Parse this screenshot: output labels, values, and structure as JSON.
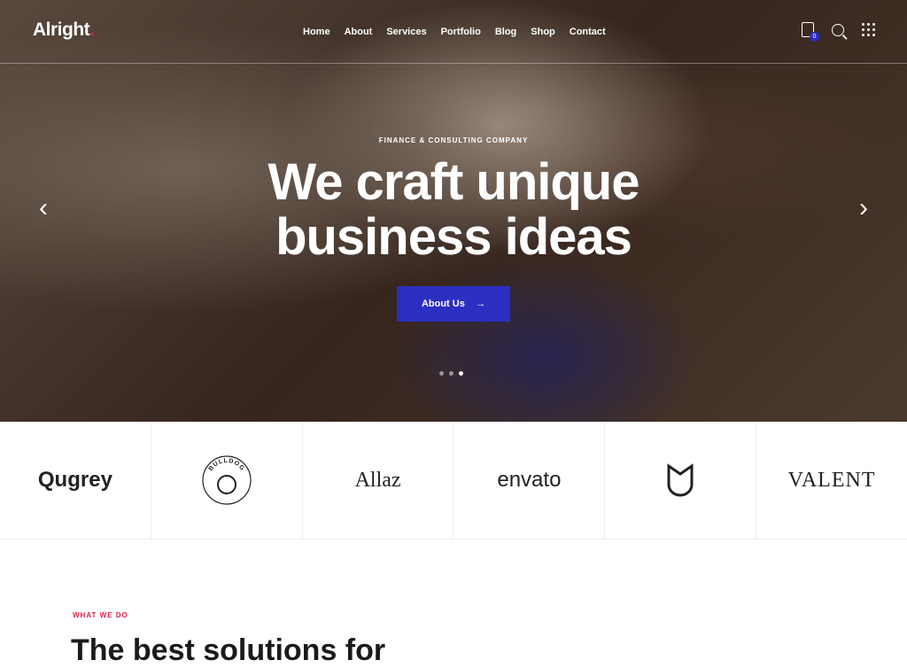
{
  "header": {
    "logo": "Alright",
    "logo_dot": ".",
    "nav": [
      "Home",
      "About",
      "Services",
      "Portfolio",
      "Blog",
      "Shop",
      "Contact"
    ],
    "cart_count": "0"
  },
  "hero": {
    "kicker": "FINANCE & CONSULTING COMPANY",
    "title_line1": "We craft unique",
    "title_line2": "business ideas",
    "button": "About Us",
    "button_arrow": "→",
    "prev": "‹",
    "next": "›",
    "slides": 3,
    "active_slide": 3
  },
  "partners": [
    "Qugrey",
    "BULLDOG",
    "Allaz",
    "envato",
    "U",
    "VALENT"
  ],
  "section": {
    "kicker": "WHAT WE DO",
    "title": "The best solutions for"
  },
  "colors": {
    "accent": "#2b2fc2",
    "red": "#e0204a"
  }
}
